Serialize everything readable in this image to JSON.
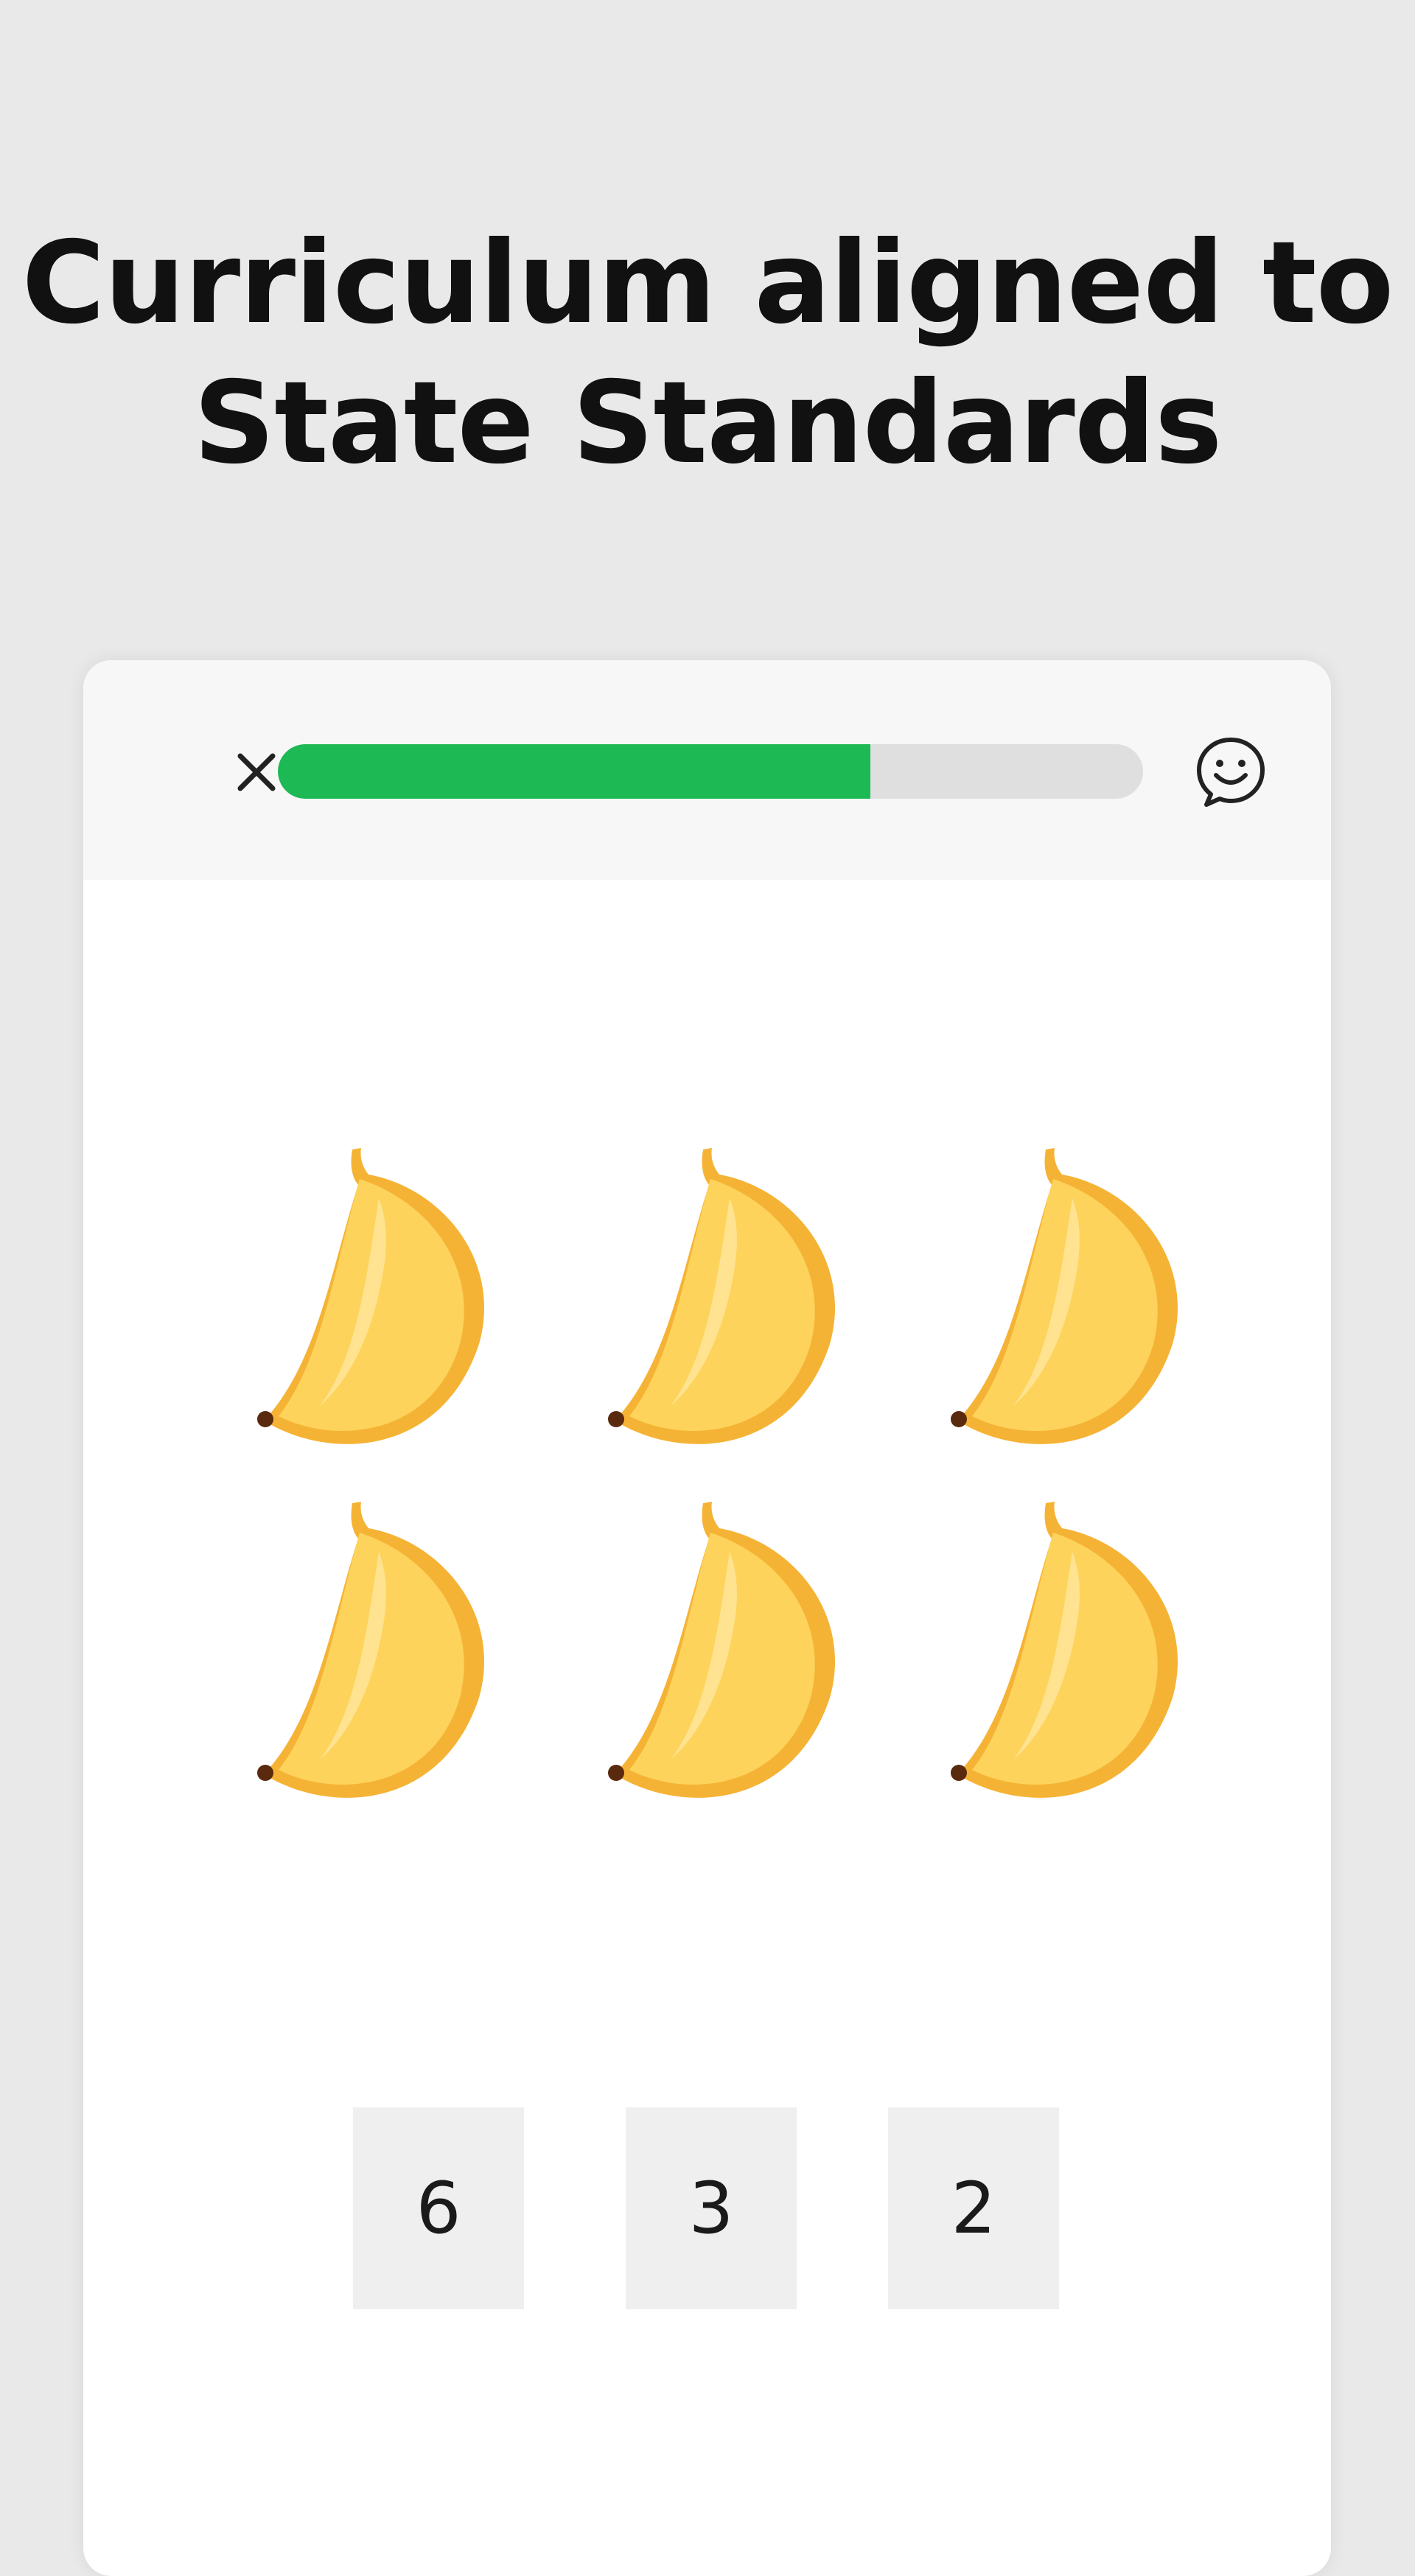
{
  "headline": {
    "line1": "Curriculum aligned to",
    "line2": "State Standards"
  },
  "header": {
    "close_icon": "close-icon",
    "chat_icon": "smiley-chat-icon",
    "progress_fraction": 0.685
  },
  "question": {
    "item_icon": "banana-icon",
    "item_count": 6
  },
  "answers": [
    "6",
    "3",
    "2"
  ],
  "colors": {
    "page_background": "#e9e9e9",
    "header_background": "#f7f7f7",
    "progress_fill": "#1db954",
    "progress_track": "#dfdfdf",
    "answer_tile": "#efefef",
    "banana_body": "#fdd35b",
    "banana_edge": "#f5b335"
  }
}
